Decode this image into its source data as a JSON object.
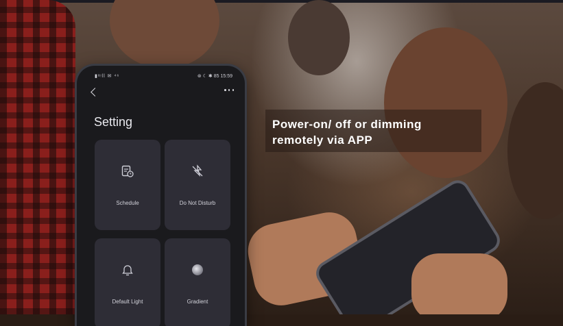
{
  "status_bar": {
    "left": "▮ᵃᵎll ✉ ⁴⁶",
    "right": "⊛ ☾ ✱ 85 15:59"
  },
  "screen": {
    "title": "Setting"
  },
  "tiles": [
    {
      "label": "Schedule",
      "icon": "schedule-icon"
    },
    {
      "label": "Do Not Disturb",
      "icon": "do-not-disturb-icon"
    },
    {
      "label": "Default Light",
      "icon": "bell-icon"
    },
    {
      "label": "Gradient",
      "icon": "gradient-dot-icon"
    }
  ],
  "caption": {
    "line1": "Power-on/ off or dimming",
    "line2": "remotely via APP"
  },
  "colors": {
    "tile": "#2e2d36",
    "screen": "#1a1a1d",
    "caption_text": "#ffffff"
  }
}
